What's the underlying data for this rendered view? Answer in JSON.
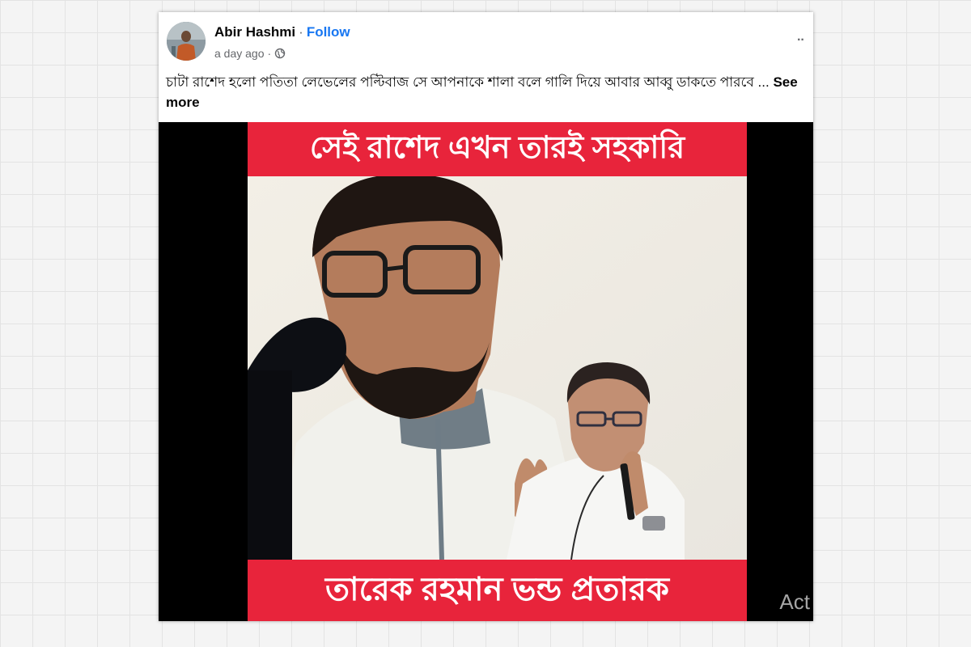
{
  "post": {
    "author": "Abir Hashmi",
    "separator": "·",
    "follow_label": "Follow",
    "timestamp": "a day ago",
    "meta_separator": "·",
    "privacy_icon": "globe-icon",
    "more_icon": "more-options-icon",
    "more_label": "··",
    "text": "চাটা রাশেদ হলো পতিতা লেভেলের পল্টিবাজ সে আপনাকে শালা বলে গালি দিয়ে আবার আব্বু ডাকতে পারবে ...",
    "see_more_label": "See more"
  },
  "media": {
    "top_banner": "সেই রাশেদ এখন তারই সহকারি",
    "bottom_banner": "তারেক রহমান ভন্ড প্রতারক",
    "watermark": "Act"
  },
  "colors": {
    "follow": "#1877f2",
    "banner": "#e8243b",
    "text": "#050505",
    "secondary": "#65676b"
  }
}
